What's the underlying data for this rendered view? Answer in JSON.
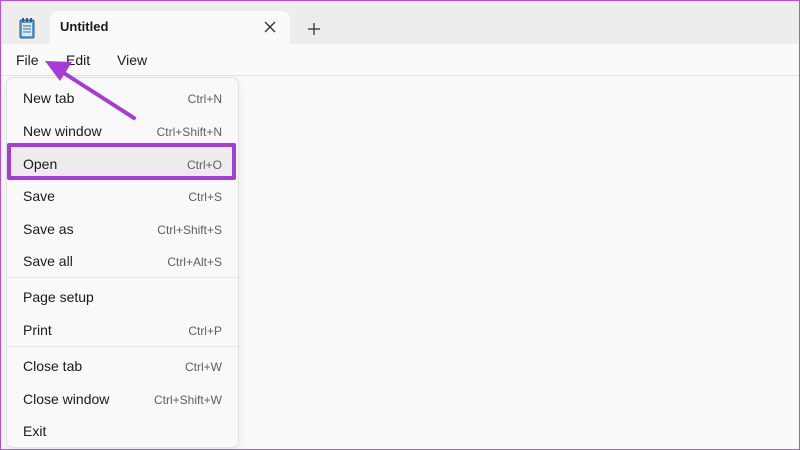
{
  "app": {
    "tab_title": "Untitled",
    "new_tab_symbol": "+",
    "icons": {
      "app": "notepad-icon",
      "close": "close-icon",
      "add": "plus-icon"
    }
  },
  "menubar": {
    "items": [
      "File",
      "Edit",
      "View"
    ]
  },
  "file_menu": {
    "items": [
      {
        "label": "New tab",
        "shortcut": "Ctrl+N"
      },
      {
        "label": "New window",
        "shortcut": "Ctrl+Shift+N"
      },
      {
        "label": "Open",
        "shortcut": "Ctrl+O"
      },
      {
        "label": "Save",
        "shortcut": "Ctrl+S"
      },
      {
        "label": "Save as",
        "shortcut": "Ctrl+Shift+S"
      },
      {
        "label": "Save all",
        "shortcut": "Ctrl+Alt+S"
      },
      {
        "label": "Page setup",
        "shortcut": ""
      },
      {
        "label": "Print",
        "shortcut": "Ctrl+P"
      },
      {
        "label": "Close tab",
        "shortcut": "Ctrl+W"
      },
      {
        "label": "Close window",
        "shortcut": "Ctrl+Shift+W"
      },
      {
        "label": "Exit",
        "shortcut": ""
      }
    ],
    "highlighted": "Open"
  },
  "annotation": {
    "color": "#a63cd6"
  }
}
